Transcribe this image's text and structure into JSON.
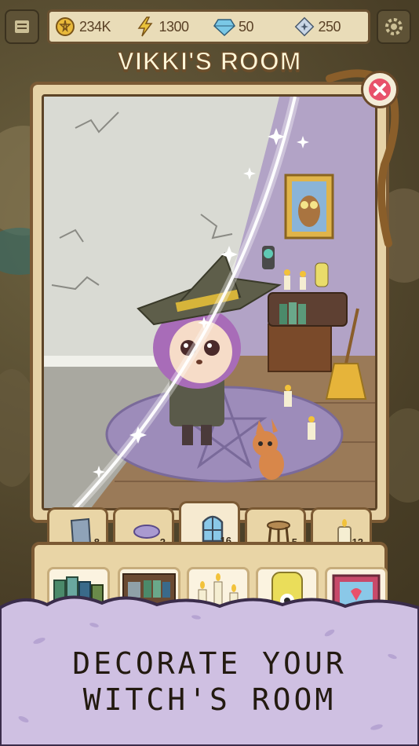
{
  "resources": [
    {
      "name": "pentacle-coin",
      "value": "234K"
    },
    {
      "name": "energy-bolt",
      "value": "1300"
    },
    {
      "name": "blue-gem",
      "value": "50"
    },
    {
      "name": "star-crystal",
      "value": "250"
    }
  ],
  "room": {
    "title": "VIKKI'S ROOM"
  },
  "categories": [
    {
      "icon": "mirror-icon",
      "count": "8"
    },
    {
      "icon": "rug-icon",
      "count": "2"
    },
    {
      "icon": "window-icon",
      "count": "16"
    },
    {
      "icon": "stool-icon",
      "count": "5"
    },
    {
      "icon": "candle-icon",
      "count": "12"
    }
  ],
  "items": [
    {
      "icon": "books-icon"
    },
    {
      "icon": "bookshelf-icon"
    },
    {
      "icon": "candles-icon"
    },
    {
      "icon": "jar-icon"
    },
    {
      "icon": "picture-icon"
    }
  ],
  "caption": {
    "line1": "DECORATE YOUR",
    "line2": "WITCH'S ROOM"
  },
  "colors": {
    "accent": "#e8516a",
    "frame": "#7b5a34",
    "wall_left": "#d9dad3",
    "wall_right": "#b2a3c6",
    "floor": "#9a7a58",
    "cloud": "#cfc0e2"
  }
}
